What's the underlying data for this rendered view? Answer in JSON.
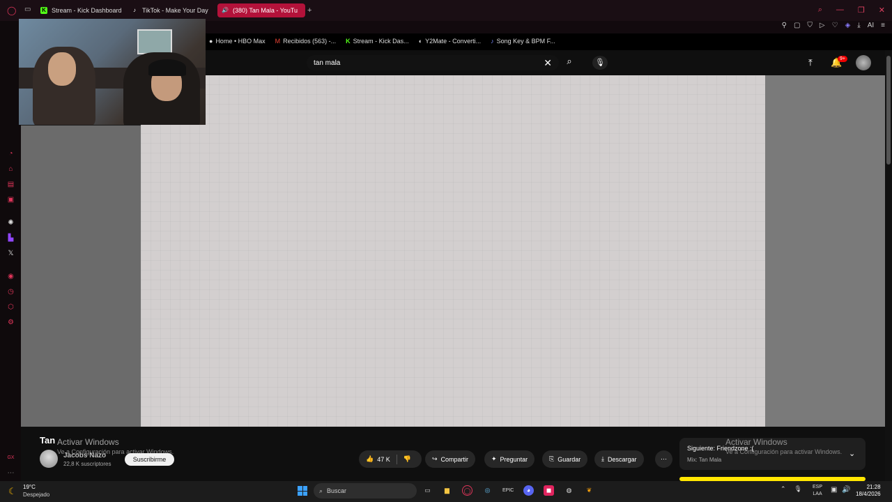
{
  "tabs": [
    {
      "label": "Stream - Kick Dashboard",
      "icon": "kick-icon"
    },
    {
      "label": "TikTok - Make Your Day",
      "icon": "tiktok-icon"
    },
    {
      "label": "(380) Tan Mala - YouTu",
      "icon": "youtube-icon",
      "active": true
    }
  ],
  "bookmarks": [
    {
      "label": "Home • HBO Max"
    },
    {
      "label": "Recibidos (563) -..."
    },
    {
      "label": "Stream - Kick Das..."
    },
    {
      "label": "Y2Mate - Converti..."
    },
    {
      "label": "Song Key & BPM F..."
    }
  ],
  "toolbar": {
    "ai_label": "AI"
  },
  "search": {
    "value": "tan mala"
  },
  "notifications": {
    "badge": "9+"
  },
  "video": {
    "title": "Tan",
    "channel_name": "Jacobs Nazo",
    "subscribers": "22,8 K suscriptores",
    "subscribe_label": "Suscribirme"
  },
  "actions": {
    "like_count": "47 K",
    "share": "Compartir",
    "ask": "Preguntar",
    "save": "Guardar",
    "download": "Descargar"
  },
  "overlay": {
    "watermark_title": "Activar Windows",
    "watermark_sub": "Ve a Configuración para activar Windows."
  },
  "next": {
    "title": "Siguiente: Friendzone :(",
    "subtitle": "Mix: Tan Mala"
  },
  "taskbar": {
    "weather_temp": "19°C",
    "weather_desc": "Despejado",
    "search_placeholder": "Buscar",
    "lang_top": "ESP",
    "lang_bottom": "LAA",
    "time": "21:28",
    "date": "18/4/2026"
  },
  "colors": {
    "accent": "#b3123a",
    "opera_red": "#e0355a",
    "youtube_bg": "#0f0f0f"
  }
}
